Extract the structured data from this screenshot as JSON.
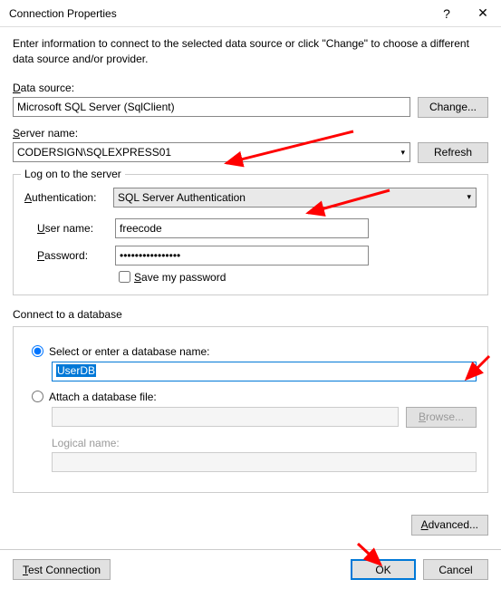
{
  "titlebar": {
    "title": "Connection Properties"
  },
  "intro": "Enter information to connect to the selected data source or click \"Change\" to choose a different data source and/or provider.",
  "dataSource": {
    "label_prefix": "D",
    "label_rest": "ata source:",
    "value": "Microsoft SQL Server (SqlClient)",
    "changeBtn": "Change..."
  },
  "serverName": {
    "label_prefix": "S",
    "label_rest": "erver name:",
    "value": "CODERSIGN\\SQLEXPRESS01",
    "refreshBtn": "Refresh"
  },
  "logon": {
    "legend": "Log on to the server",
    "authLabel_prefix": "A",
    "authLabel_rest": "uthentication:",
    "authValue": "SQL Server Authentication",
    "userLabel_prefix": "U",
    "userLabel_rest": "ser name:",
    "userValue": "freecode",
    "passLabel_prefix": "P",
    "passLabel_rest": "assword:",
    "passValue": "••••••••••••••••",
    "saveLabel_prefix": "S",
    "saveLabel_rest": "ave my password"
  },
  "db": {
    "section": "Connect to a database",
    "radio1": "Select or enter a database name:",
    "dbValue": "UserDB",
    "radio2": "Attach a database file:",
    "browseBtn": "Browse...",
    "logicalLabel": "Logical name:"
  },
  "advancedBtn": "Advanced...",
  "footer": {
    "testBtn_prefix": "T",
    "testBtn_rest": "est Connection",
    "okBtn": "OK",
    "cancelBtn": "Cancel"
  }
}
